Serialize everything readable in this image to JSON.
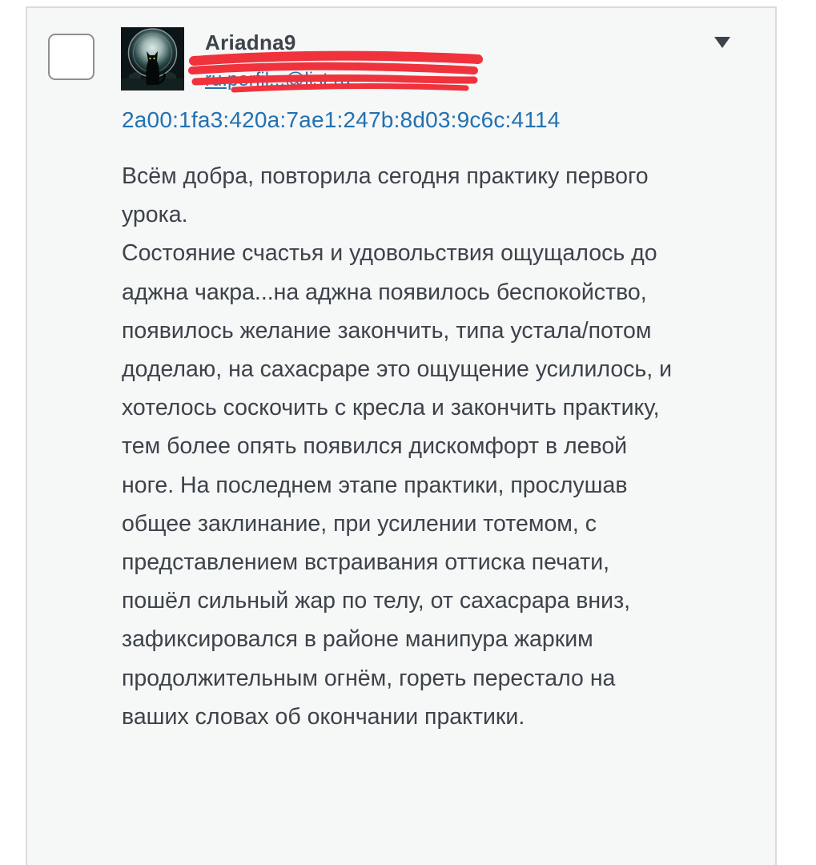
{
  "comment": {
    "author": "Ariadna9",
    "profile_link": "ru.perfil...@list.ru",
    "ip": "2a00:1fa3:420a:7ae1:247b:8d03:9c6c:4114",
    "paragraphs": [
      "Всём добра, повторила сегодня практику первого урока.",
      "Состояние счастья и удовольствия ощущалось до аджна чакра...на аджна появилось беспокойство, появилось желание закончить, типа устала/потом доделаю, на сахасраре это ощущение усилилось, и хотелось соскочить с кресла и закончить практику, тем более опять появился дискомфорт в левой ноге. На последнем этапе практики, прослушав общее заклинание, при усилении тотемом, с представлением встраивания оттиска печати, пошёл сильный жар по телу, от сахасрара вниз, зафиксировался в районе манипура жарким продолжительным огнём, гореть перестало на ваших словах об окончании практики."
    ]
  },
  "icons": {
    "menu": "triangle-down-icon",
    "avatar": "black-cat-avatar"
  },
  "colors": {
    "link": "#2271b1",
    "text": "#3c434a",
    "card_bg": "#f6f7f7",
    "redaction": "#f0323c"
  }
}
